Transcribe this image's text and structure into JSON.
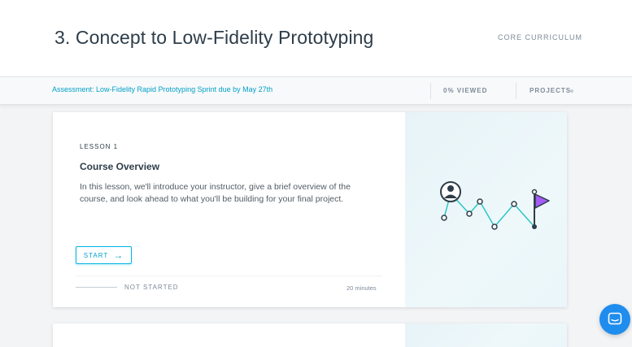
{
  "header": {
    "title": "3. Concept to Low-Fidelity Prototyping",
    "curriculum_link": "CORE CURRICULUM"
  },
  "subbar": {
    "assessment": "Assessment: Low-Fidelity Rapid Prototyping Sprint due by May 27th",
    "viewed": "0% VIEWED",
    "projects": "PROJECTS"
  },
  "lessons": [
    {
      "number": "LESSON 1",
      "title": "Course Overview",
      "description": "In this lesson, we'll introduce your instructor, give a brief overview of the course, and look ahead to what you'll be building for your final project.",
      "button_label": "START",
      "status": "NOT STARTED",
      "duration": "20 minutes",
      "progress": 0
    }
  ],
  "colors": {
    "accent": "#02b3e4",
    "path": "#2cc6c6",
    "flag": "#a45cf5",
    "chat": "#1f8ded"
  },
  "icons": {
    "start_arrow": "arrow-right-icon",
    "chat": "chat-bubble-icon",
    "illustration": "learning-path-illustration"
  }
}
